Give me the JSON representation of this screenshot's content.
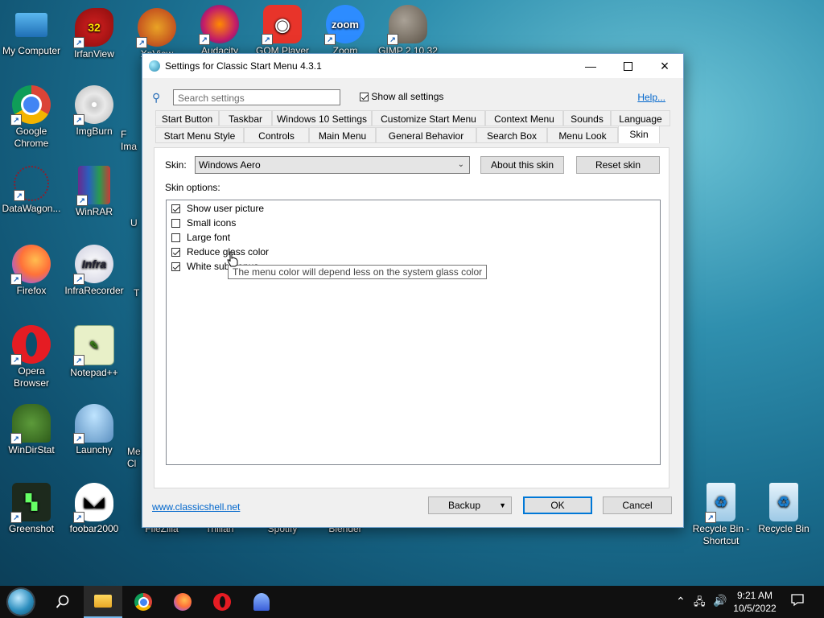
{
  "desktop": {
    "icons": [
      {
        "label": "My Computer",
        "name": "my-computer-icon"
      },
      {
        "label": "IrfanView",
        "name": "irfanview-icon"
      },
      {
        "label": "XnView",
        "name": "xnview-icon"
      },
      {
        "label": "Audacity",
        "name": "audacity-icon"
      },
      {
        "label": "GOM Player",
        "name": "gom-player-icon"
      },
      {
        "label": "Zoom",
        "name": "zoom-icon"
      },
      {
        "label": "GIMP 2.10.32",
        "name": "gimp-icon"
      },
      {
        "label": "Google Chrome",
        "name": "chrome-icon"
      },
      {
        "label": "ImgBurn",
        "name": "imgburn-icon"
      },
      {
        "label": "F\nIma",
        "name": "partial-icon-1"
      },
      {
        "label": "DataWagon...",
        "name": "datawagon-icon"
      },
      {
        "label": "WinRAR",
        "name": "winrar-icon"
      },
      {
        "label": "U",
        "name": "partial-icon-2"
      },
      {
        "label": "Firefox",
        "name": "firefox-icon"
      },
      {
        "label": "InfraRecorder",
        "name": "infrarecorder-icon"
      },
      {
        "label": "T",
        "name": "partial-icon-3"
      },
      {
        "label": "Opera Browser",
        "name": "opera-icon"
      },
      {
        "label": "Notepad++",
        "name": "notepadpp-icon"
      },
      {
        "label": "WinDirStat",
        "name": "windirstat-icon"
      },
      {
        "label": "Launchy",
        "name": "launchy-icon"
      },
      {
        "label": "Me\nCl",
        "name": "partial-icon-4"
      },
      {
        "label": "Greenshot",
        "name": "greenshot-icon"
      },
      {
        "label": "foobar2000",
        "name": "foobar2000-icon"
      },
      {
        "label": "FileZilla",
        "name": "filezilla-icon"
      },
      {
        "label": "Trillian",
        "name": "trillian-icon"
      },
      {
        "label": "Spotify",
        "name": "spotify-icon"
      },
      {
        "label": "Blender",
        "name": "blender-icon"
      },
      {
        "label": "Recycle Bin - Shortcut",
        "name": "recycle-bin-shortcut-icon"
      },
      {
        "label": "Recycle Bin",
        "name": "recycle-bin-icon"
      }
    ],
    "irfan_badge": "32",
    "zoom_text": "zoom",
    "infra_text": "Infra"
  },
  "dialog": {
    "title": "Settings for Classic Start Menu 4.3.1",
    "search_placeholder": "Search settings",
    "show_all_label": "Show all settings",
    "help_label": "Help...",
    "tabs_row1": [
      "Start Button",
      "Taskbar",
      "Windows 10 Settings",
      "Customize Start Menu",
      "Context Menu",
      "Sounds",
      "Language"
    ],
    "tabs_row2": [
      "Start Menu Style",
      "Controls",
      "Main Menu",
      "General Behavior",
      "Search Box",
      "Menu Look",
      "Skin"
    ],
    "skin_label": "Skin:",
    "skin_value": "Windows Aero",
    "about_skin": "About this skin",
    "reset_skin": "Reset skin",
    "skin_options_label": "Skin options:",
    "options": [
      {
        "label": "Show user picture",
        "checked": true
      },
      {
        "label": "Small icons",
        "checked": false
      },
      {
        "label": "Large font",
        "checked": false
      },
      {
        "label": "Reduce glass color",
        "checked": true
      },
      {
        "label": "White submenus",
        "checked": true
      }
    ],
    "tooltip": "The menu color will depend less on the system glass color",
    "link": "www.classicshell.net",
    "backup": "Backup",
    "ok": "OK",
    "cancel": "Cancel"
  },
  "taskbar": {
    "time": "9:21 AM",
    "date": "10/5/2022"
  }
}
